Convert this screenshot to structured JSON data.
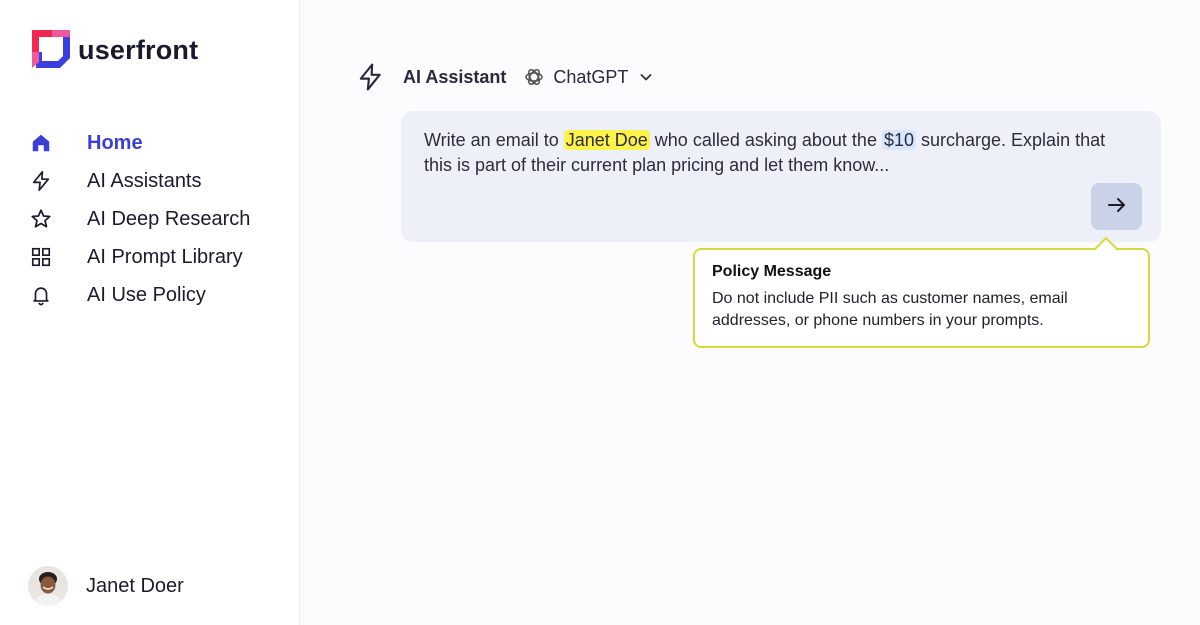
{
  "brand": {
    "name": "userfront",
    "colors": {
      "red": "#f2294e",
      "blue": "#3c3fe0",
      "pink": "#f0579d"
    }
  },
  "sidebar": {
    "items": [
      {
        "label": "Home",
        "icon": "home-icon",
        "active": true
      },
      {
        "label": "AI Assistants",
        "icon": "lightning-icon",
        "active": false
      },
      {
        "label": "AI Deep Research",
        "icon": "star-icon",
        "active": false
      },
      {
        "label": "AI Prompt Library",
        "icon": "grid-icon",
        "active": false
      },
      {
        "label": "AI Use Policy",
        "icon": "bell-icon",
        "active": false
      }
    ],
    "accent_color": "#3b3fd6"
  },
  "user": {
    "name": "Janet Doer",
    "avatar_icon": "avatar"
  },
  "toolbar": {
    "title": "AI Assistant",
    "title_icon": "lightning-icon",
    "model": {
      "name": "ChatGPT",
      "icon": "openai-icon",
      "dropdown_icon": "chevron-down-icon"
    }
  },
  "prompt": {
    "segments": {
      "s1": "Write an email to ",
      "name": "Janet Doe",
      "s2": " who called asking about the ",
      "amount": "$10",
      "s3": " surcharge. Explain that this is part of their current plan pricing and let them know..."
    },
    "highlight_colors": {
      "name": "#fbf24a",
      "amount": "#d6e6fb"
    },
    "send_icon": "arrow-right-icon"
  },
  "policy": {
    "title": "Policy Message",
    "body": "Do not include PII such as customer names, email addresses, or phone numbers in your prompts.",
    "border_color": "#d7d93a"
  }
}
